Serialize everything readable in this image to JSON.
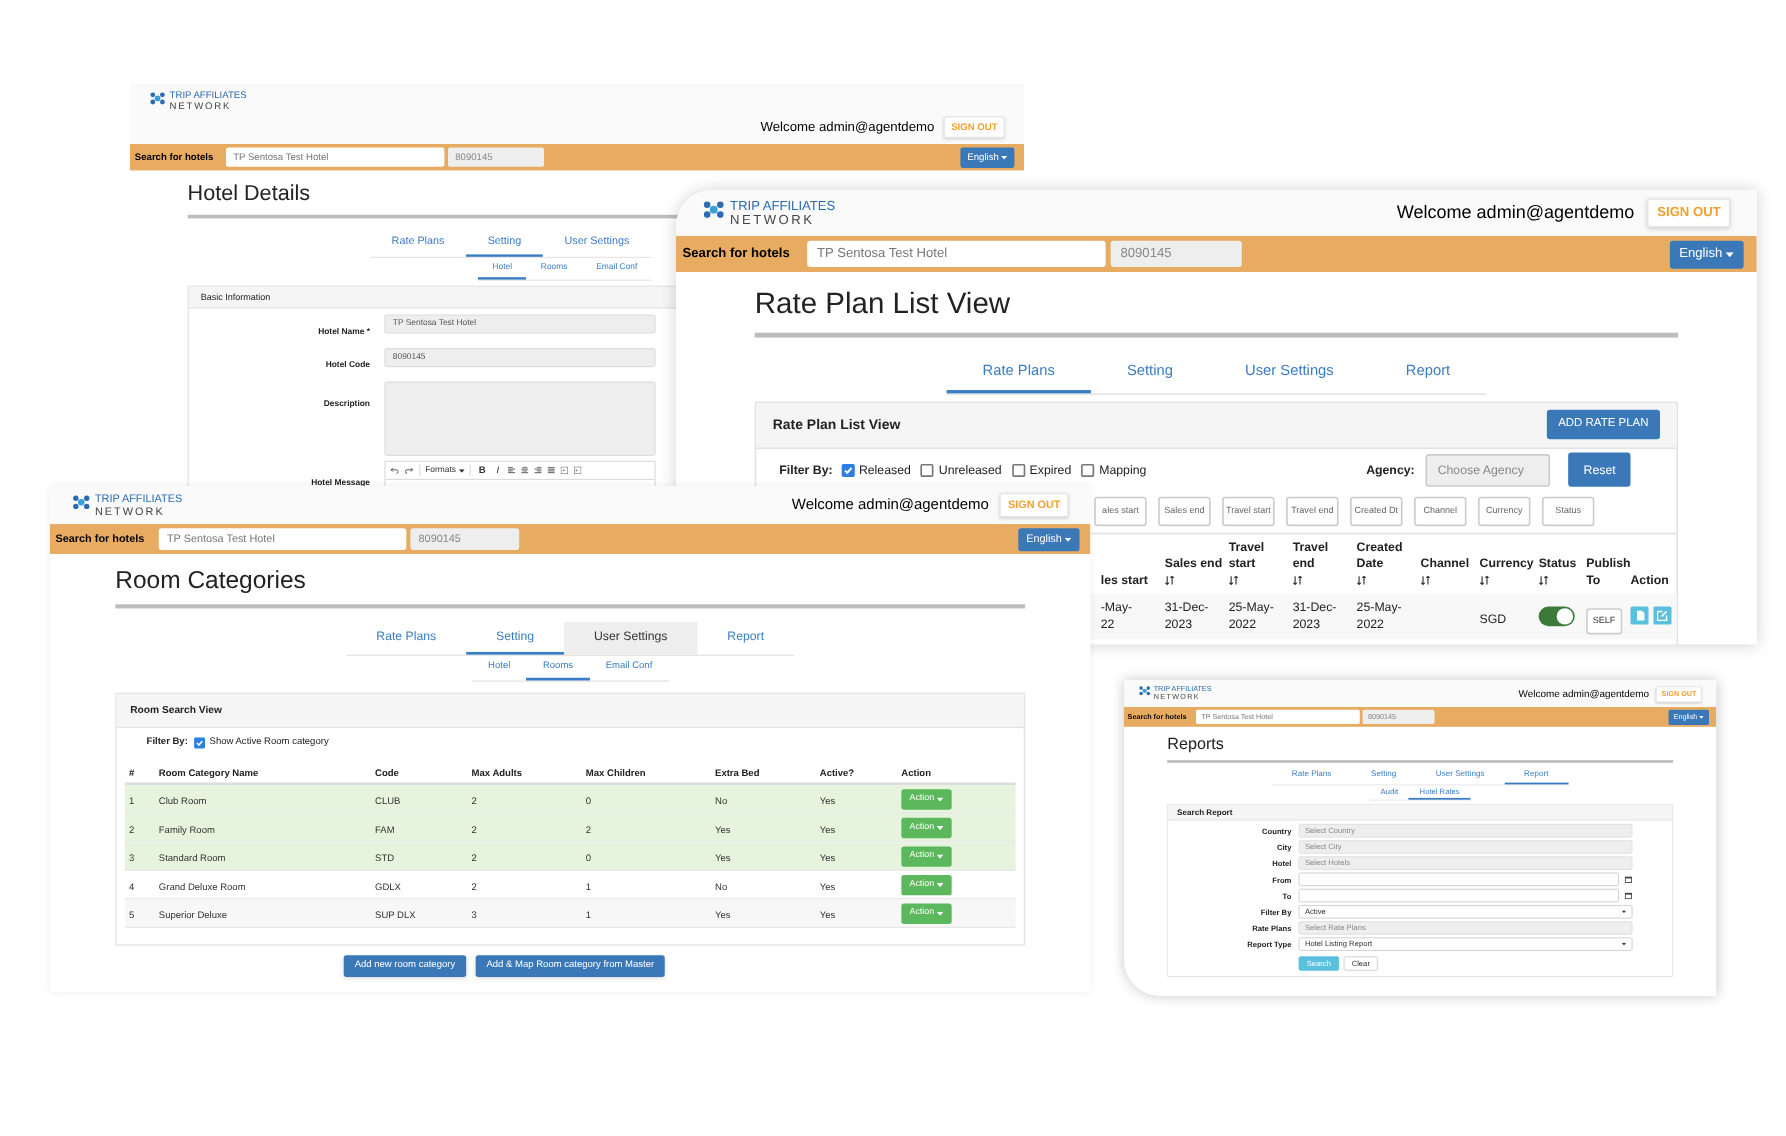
{
  "hotel_details_window": {
    "header": {
      "logo_line_1": "TRIP AFFILIATES",
      "logo_line_2": "NETWORK",
      "welcome": "Welcome admin@agentdemo",
      "sign_out": "SIGN OUT",
      "search_label": "Search for hotels",
      "search_value": "TP Sentosa Test Hotel",
      "hotel_code": "8090145",
      "language": "English"
    },
    "title": "Hotel Details",
    "tabs": [
      {
        "label": "Rate Plans",
        "selected": false
      },
      {
        "label": "Setting",
        "selected": true
      },
      {
        "label": "User Settings",
        "selected": false
      }
    ],
    "subtabs": [
      {
        "label": "Hotel",
        "selected": true
      },
      {
        "label": "Rooms",
        "selected": false
      },
      {
        "label": "Email Conf",
        "selected": false
      }
    ],
    "panel_title": "Basic Information",
    "fields": [
      {
        "kind": "text",
        "label": "Hotel Name *",
        "value": "TP Sentosa Test Hotel"
      },
      {
        "kind": "text",
        "label": "Hotel Code",
        "value": "8090145"
      },
      {
        "kind": "textarea",
        "label": "Description"
      },
      {
        "kind": "editor",
        "label": "Hotel Message",
        "toolbar": [
          {
            "kind": "undo"
          },
          {
            "kind": "redo"
          },
          {
            "kind": "dropdown",
            "label": "Formats"
          },
          {
            "kind": "bold_text",
            "label": "B"
          },
          {
            "kind": "italic_text",
            "label": "I"
          },
          {
            "kind": "align_left"
          },
          {
            "kind": "align_center"
          },
          {
            "kind": "align_right"
          },
          {
            "kind": "align_justify"
          },
          {
            "kind": "outdent"
          },
          {
            "kind": "indent"
          }
        ]
      }
    ]
  },
  "rate_plan_window": {
    "header": {
      "logo_line_1": "TRIP AFFILIATES",
      "logo_line_2": "NETWORK",
      "welcome": "Welcome admin@agentdemo",
      "sign_out": "SIGN OUT",
      "search_label": "Search for hotels",
      "search_value": "TP Sentosa Test Hotel",
      "hotel_code": "8090145",
      "language": "English"
    },
    "title": "Rate Plan List View",
    "tabs": [
      {
        "label": "Rate Plans",
        "selected": true
      },
      {
        "label": "Setting",
        "selected": false
      },
      {
        "label": "User Settings",
        "selected": false
      },
      {
        "label": "Report",
        "selected": false
      }
    ],
    "panel_title": "Rate Plan List View",
    "add_button": "ADD RATE PLAN",
    "filter_label": "Filter By:",
    "filters": [
      {
        "label": "Released",
        "checked": true
      },
      {
        "label": "Unreleased",
        "checked": false
      },
      {
        "label": "Expired",
        "checked": false
      },
      {
        "label": "Mapping",
        "checked": false
      }
    ],
    "agency_label": "Agency:",
    "agency_placeholder": "Choose Agency",
    "reset_button": "Reset",
    "column_filters": [
      "ales start",
      "Sales end",
      "Travel start",
      "Travel end",
      "Created Dt",
      "Channel",
      "Currency",
      "Status"
    ],
    "columns": [
      {
        "label": "les start",
        "sortable": false
      },
      {
        "label": "Sales end",
        "sortable": true
      },
      {
        "label": "Travel start",
        "sortable": true
      },
      {
        "label": "Travel end",
        "sortable": true
      },
      {
        "label": "Created Date",
        "sortable": true
      },
      {
        "label": "Channel",
        "sortable": true
      },
      {
        "label": "Currency",
        "sortable": true
      },
      {
        "label": "Status",
        "sortable": true
      },
      {
        "label": "Publish To",
        "sortable": false
      },
      {
        "label": "Action",
        "sortable": false
      }
    ],
    "rows": [
      {
        "sales_start": "-May-22",
        "sales_end": "31-Dec-2023",
        "travel_start": "25-May-2022",
        "travel_end": "31-Dec-2023",
        "created_date": "25-May-2022",
        "currency": "SGD",
        "status_on": true,
        "publish_to": "SELF"
      }
    ]
  },
  "room_categories_window": {
    "header": {
      "logo_line_1": "TRIP AFFILIATES",
      "logo_line_2": "NETWORK",
      "welcome": "Welcome admin@agentdemo",
      "sign_out": "SIGN OUT",
      "search_label": "Search for hotels",
      "search_value": "TP Sentosa Test Hotel",
      "hotel_code": "8090145",
      "language": "English"
    },
    "title": "Room Categories",
    "tabs": [
      {
        "label": "Rate Plans",
        "selected": false,
        "hovered": false
      },
      {
        "label": "Setting",
        "selected": true,
        "hovered": false
      },
      {
        "label": "User Settings",
        "selected": false,
        "hovered": true
      },
      {
        "label": "Report",
        "selected": false,
        "hovered": false
      }
    ],
    "subtabs": [
      {
        "label": "Hotel",
        "selected": false
      },
      {
        "label": "Rooms",
        "selected": true
      },
      {
        "label": "Email Conf",
        "selected": false
      }
    ],
    "panel_title": "Room Search View",
    "filter_label": "Filter By:",
    "filter": {
      "label": "Show Active Room category",
      "checked": true
    },
    "columns": [
      "#",
      "Room Category Name",
      "Code",
      "Max Adults",
      "Max Children",
      "Extra Bed",
      "Active?",
      "Action"
    ],
    "rows": [
      {
        "number": "1",
        "name": "Club Room",
        "code": "CLUB",
        "max_adults": "2",
        "max_children": "0",
        "extra_bed": "No",
        "active": "Yes",
        "action": "Action",
        "highlighted": true
      },
      {
        "number": "2",
        "name": "Family Room",
        "code": "FAM",
        "max_adults": "2",
        "max_children": "2",
        "extra_bed": "Yes",
        "active": "Yes",
        "action": "Action",
        "highlighted": true
      },
      {
        "number": "3",
        "name": "Standard Room",
        "code": "STD",
        "max_adults": "2",
        "max_children": "0",
        "extra_bed": "Yes",
        "active": "Yes",
        "action": "Action",
        "highlighted": true
      },
      {
        "number": "4",
        "name": "Grand Deluxe Room",
        "code": "GDLX",
        "max_adults": "2",
        "max_children": "1",
        "extra_bed": "No",
        "active": "Yes",
        "action": "Action",
        "highlighted": false
      },
      {
        "number": "5",
        "name": "Superior Deluxe",
        "code": "SUP DLX",
        "max_adults": "3",
        "max_children": "1",
        "extra_bed": "Yes",
        "active": "Yes",
        "action": "Action",
        "highlighted": false
      }
    ],
    "buttons": [
      "Add new room category",
      "Add & Map Room category from Master"
    ]
  },
  "reports_window": {
    "header": {
      "logo_line_1": "TRIP AFFILIATES",
      "logo_line_2": "NETWORK",
      "welcome": "Welcome admin@agentdemo",
      "sign_out": "SIGN OUT",
      "search_label": "Search for hotels",
      "search_value": "TP Sentosa Test Hotel",
      "hotel_code": "8090145",
      "language": "English"
    },
    "title": "Reports",
    "tabs": [
      {
        "label": "Rate Plans",
        "selected": false
      },
      {
        "label": "Setting",
        "selected": false
      },
      {
        "label": "User Settings",
        "selected": false
      },
      {
        "label": "Report",
        "selected": true
      }
    ],
    "subtabs": [
      {
        "label": "Audit",
        "selected": false
      },
      {
        "label": "Hotel Rates",
        "selected": true
      }
    ],
    "panel_title": "Search Report",
    "fields": [
      {
        "kind": "select",
        "label": "Country",
        "placeholder": "Select Country"
      },
      {
        "kind": "select",
        "label": "City",
        "placeholder": "Select City"
      },
      {
        "kind": "select",
        "label": "Hotel",
        "placeholder": "Select Hotels"
      },
      {
        "kind": "date",
        "label": "From"
      },
      {
        "kind": "date",
        "label": "To"
      },
      {
        "kind": "dropdown",
        "label": "Filter By",
        "value": "Active"
      },
      {
        "kind": "select",
        "label": "Rate Plans",
        "placeholder": "Select Rate Plans"
      },
      {
        "kind": "dropdown",
        "label": "Report Type",
        "value": "Hotel Listing Report"
      }
    ],
    "buttons": [
      {
        "label": "Search",
        "primary": true
      },
      {
        "label": "Clear",
        "primary": false
      }
    ]
  }
}
